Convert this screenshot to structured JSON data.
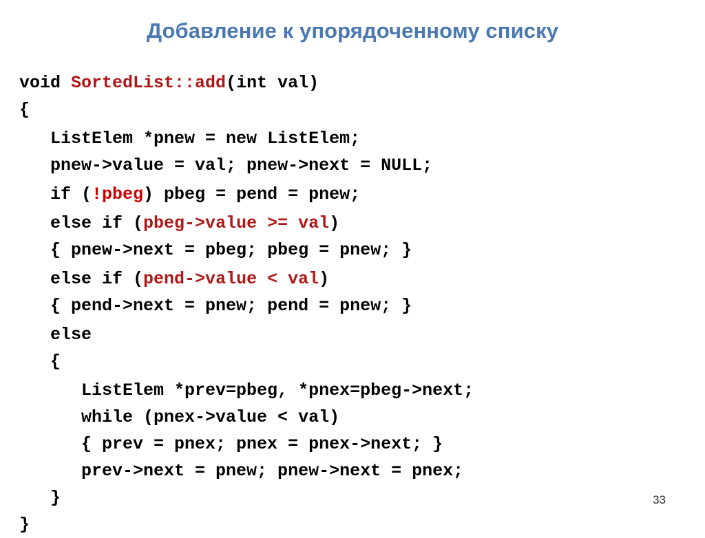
{
  "slide": {
    "title": "Добавление к упорядоченному списку",
    "page_number": "33",
    "colors": {
      "title": "#4a78b0",
      "code_default": "#000000",
      "code_identifier_red": "#b01717",
      "code_highlight_red": "#cc0000",
      "background": "#ffffff"
    },
    "language": "C++",
    "code": {
      "lines": [
        {
          "id": "line-1",
          "indent": 0,
          "tokens": [
            {
              "text": "void ",
              "color": "black"
            },
            {
              "text": "SortedList::add",
              "color": "darkred"
            },
            {
              "text": "(int val)",
              "color": "black"
            }
          ],
          "plain": "void SortedList::add(int val)"
        },
        {
          "id": "line-2",
          "indent": 0,
          "tokens": [
            {
              "text": "{",
              "color": "black"
            }
          ],
          "plain": "{"
        },
        {
          "id": "line-3",
          "indent": 3,
          "gap_before": true,
          "tokens": [
            {
              "text": "ListElem *pnew = new ListElem;",
              "color": "black"
            }
          ],
          "plain": "   ListElem *pnew = new ListElem;"
        },
        {
          "id": "line-4",
          "indent": 3,
          "tokens": [
            {
              "text": "pnew->value = val; pnew->next = NULL;",
              "color": "black"
            }
          ],
          "plain": "   pnew->value = val; pnew->next = NULL;"
        },
        {
          "id": "line-5",
          "indent": 3,
          "gap_before": true,
          "tokens": [
            {
              "text": "if (",
              "color": "black"
            },
            {
              "text": "!pbeg",
              "color": "red"
            },
            {
              "text": ") pbeg = pend = pnew;",
              "color": "black"
            }
          ],
          "plain": "   if (!pbeg) pbeg = pend = pnew;"
        },
        {
          "id": "line-6",
          "indent": 3,
          "gap_before": true,
          "tokens": [
            {
              "text": "else if (",
              "color": "black"
            },
            {
              "text": "pbeg->value >= val",
              "color": "darkred"
            },
            {
              "text": ")",
              "color": "black"
            }
          ],
          "plain": "   else if (pbeg->value >= val)"
        },
        {
          "id": "line-7",
          "indent": 3,
          "tokens": [
            {
              "text": "{ pnew->next = pbeg; pbeg = pnew; }",
              "color": "black"
            }
          ],
          "plain": "   { pnew->next = pbeg; pbeg = pnew; }"
        },
        {
          "id": "line-8",
          "indent": 3,
          "gap_before": true,
          "tokens": [
            {
              "text": "else if (",
              "color": "black"
            },
            {
              "text": "pend->value < val",
              "color": "darkred"
            },
            {
              "text": ")",
              "color": "black"
            }
          ],
          "plain": "   else if (pend->value < val)"
        },
        {
          "id": "line-9",
          "indent": 3,
          "tokens": [
            {
              "text": "{ pend->next = pnew; pend = pnew; }",
              "color": "black"
            }
          ],
          "plain": "   { pend->next = pnew; pend = pnew; }"
        },
        {
          "id": "line-10",
          "indent": 3,
          "gap_before": true,
          "tokens": [
            {
              "text": "else",
              "color": "black"
            }
          ],
          "plain": "   else"
        },
        {
          "id": "line-11",
          "indent": 3,
          "tokens": [
            {
              "text": "{",
              "color": "black"
            }
          ],
          "plain": "   {"
        },
        {
          "id": "line-12",
          "indent": 6,
          "gap_before": true,
          "tokens": [
            {
              "text": "ListElem *prev=pbeg, *pnex=pbeg->next;",
              "color": "black"
            }
          ],
          "plain": "      ListElem *prev=pbeg, *pnex=pbeg->next;"
        },
        {
          "id": "line-13",
          "indent": 6,
          "tokens": [
            {
              "text": "while (pnex->value < val)",
              "color": "black"
            }
          ],
          "plain": "      while (pnex->value < val)"
        },
        {
          "id": "line-14",
          "indent": 6,
          "tokens": [
            {
              "text": "{ prev = pnex; pnex = pnex->next; }",
              "color": "black"
            }
          ],
          "plain": "      { prev = pnex; pnex = pnex->next; }"
        },
        {
          "id": "line-15",
          "indent": 6,
          "tokens": [
            {
              "text": "prev->next = pnew; pnew->next = pnex;",
              "color": "black"
            }
          ],
          "plain": "      prev->next = pnew; pnew->next = pnex;"
        },
        {
          "id": "line-16",
          "indent": 3,
          "tokens": [
            {
              "text": "}",
              "color": "black"
            }
          ],
          "plain": "   }"
        },
        {
          "id": "line-17",
          "indent": 0,
          "tokens": [
            {
              "text": "}",
              "color": "black"
            }
          ],
          "plain": "}"
        }
      ]
    }
  }
}
